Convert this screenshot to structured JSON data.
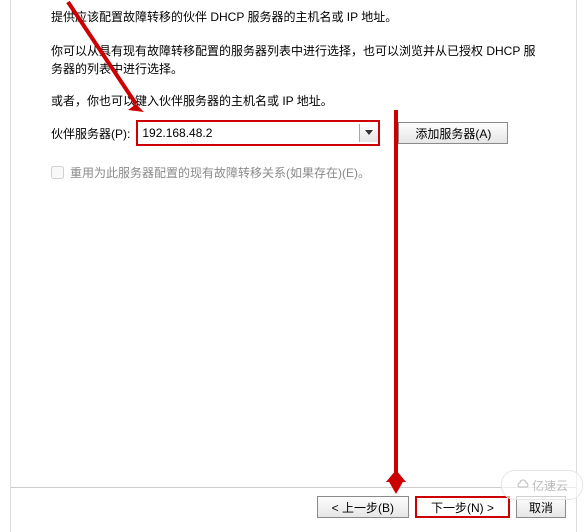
{
  "intro": {
    "line1": "提供应该配置故障转移的伙伴 DHCP 服务器的主机名或 IP 地址。",
    "line2": "你可以从具有现有故障转移配置的服务器列表中进行选择，也可以浏览并从已授权 DHCP 服务器的列表中进行选择。",
    "line3": "或者，你也可以键入伙伴服务器的主机名或 IP 地址。"
  },
  "partner": {
    "label": "伙伴服务器(P):",
    "value": "192.168.48.2",
    "add_button": "添加服务器(A)"
  },
  "reuse": {
    "label": "重用为此服务器配置的现有故障转移关系(如果存在)(E)。",
    "checked": false,
    "disabled": true
  },
  "wizard": {
    "back": "< 上一步(B)",
    "next": "下一步(N) >",
    "cancel": "取消"
  },
  "icons": {
    "dropdown": "chevron-down-icon"
  },
  "watermark": "亿速云",
  "annotation_color": "#cc0000"
}
